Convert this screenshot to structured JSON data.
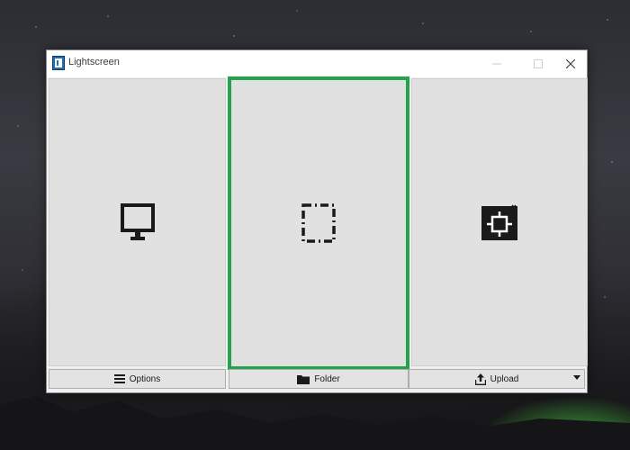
{
  "window": {
    "title": "Lightscreen"
  },
  "titlebar": {
    "controls": [
      "minimize-icon",
      "maximize-icon",
      "close-icon"
    ]
  },
  "panels": [
    {
      "name": "screen",
      "icon": "monitor-icon"
    },
    {
      "name": "area",
      "icon": "dashed-selection-icon",
      "highlighted": true
    },
    {
      "name": "window",
      "icon": "window-target-icon"
    }
  ],
  "buttons": {
    "options_label": "Options",
    "folder_label": "Folder",
    "upload_label": "Upload"
  },
  "colors": {
    "highlight": "#23a44c",
    "panel_bg": "#e1e1e1",
    "icon": "#1a1a1a"
  }
}
